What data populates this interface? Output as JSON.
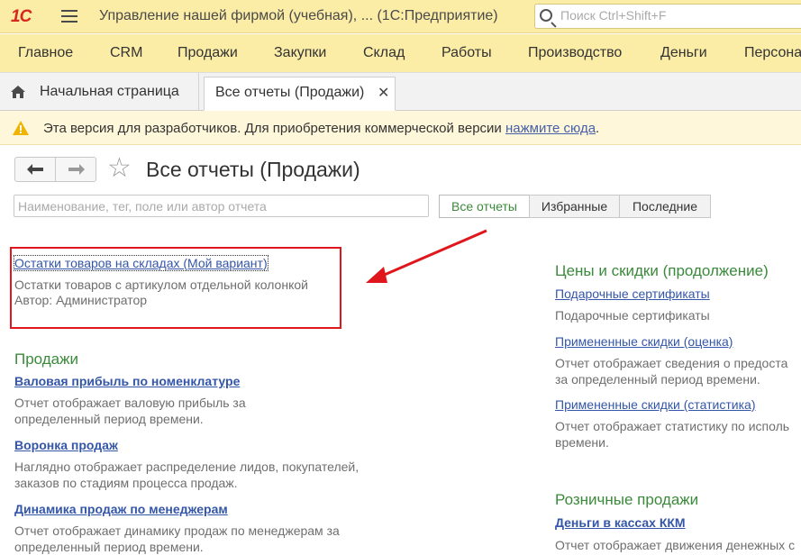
{
  "titlebar": {
    "logo": "1С",
    "app_title": "Управление нашей фирмой (учебная), ...   (1С:Предприятие)",
    "search_placeholder": "Поиск Ctrl+Shift+F"
  },
  "sections": [
    "Главное",
    "CRM",
    "Продажи",
    "Закупки",
    "Склад",
    "Работы",
    "Производство",
    "Деньги",
    "Персона"
  ],
  "tabs": {
    "home": "Начальная страница",
    "active": "Все отчеты (Продажи)",
    "close": "✕"
  },
  "notice": {
    "text": "Эта версия для разработчиков. Для приобретения коммерческой версии ",
    "link": "нажмите сюда",
    "suffix": "."
  },
  "form": {
    "title": "Все отчеты (Продажи)",
    "back": "🡐",
    "forward": "🡒",
    "star": "☆",
    "filter_placeholder": "Наименование, тег, поле или автор отчета",
    "filters": [
      "Все отчеты",
      "Избранные",
      "Последние"
    ]
  },
  "left": {
    "highlighted": {
      "link": "Остатки товаров на складах (Мой вариант)",
      "desc": "Остатки товаров с артикулом отдельной колонкой",
      "author": "Автор: Администратор"
    },
    "group": "Продажи",
    "reports": [
      {
        "link": "Валовая прибыль по номенклатуре",
        "desc": "Отчет отображает валовую прибыль за определенный период времени."
      },
      {
        "link": "Воронка продаж",
        "desc": "Наглядно отображает распределение лидов, покупателей, заказов по стадиям процесса продаж."
      },
      {
        "link": "Динамика продаж по менеджерам",
        "desc": "Отчет отображает динамику продаж по менеджерам за определенный период времени."
      }
    ]
  },
  "right": {
    "group1": "Цены и скидки (продолжение)",
    "reports1": [
      {
        "link": "Подарочные сертификаты",
        "desc": "Подарочные сертификаты"
      },
      {
        "link": "Примененные скидки (оценка)",
        "desc": "Отчет отображает сведения о предоста за определенный период времени."
      },
      {
        "link": "Примененные скидки (статистика)",
        "desc": "Отчет отображает статистику по исполь времени."
      }
    ],
    "group2": "Розничные продажи",
    "reports2": [
      {
        "link": "Деньги в кассах ККМ",
        "desc": "Отчет отображает движения денежных с"
      }
    ]
  },
  "colors": {
    "accent_yellow": "#fbeca6",
    "green_title": "#3b8a3b",
    "link_blue": "#3456a8",
    "highlight_red": "#e0161d"
  }
}
